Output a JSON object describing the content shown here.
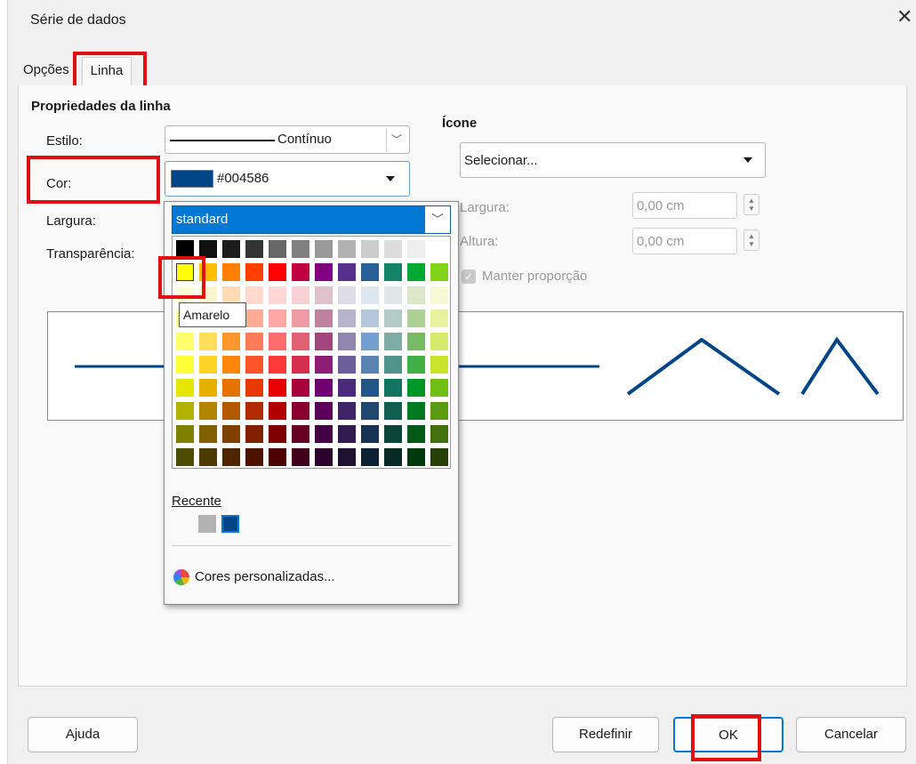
{
  "window": {
    "title": "Série de dados",
    "close": "✕"
  },
  "tabs": [
    {
      "label": "Opções"
    },
    {
      "label": "Linha"
    }
  ],
  "line_props": {
    "heading": "Propriedades da linha",
    "style_label": "Estilo:",
    "style_value": "Contínuo",
    "color_label": "Cor:",
    "color_value": "#004586",
    "color_hex": "#004586",
    "width_label": "Largura:",
    "transparency_label": "Transparência:"
  },
  "icon": {
    "heading": "Ícone",
    "select_value": "Selecionar...",
    "width_label": "Largura:",
    "width_value": "0,00 cm",
    "height_label": "Altura:",
    "height_value": "0,00 cm",
    "keep_ratio_label": "Manter proporção"
  },
  "color_popup": {
    "palette": "standard",
    "tooltip": "Amarelo",
    "recent_label": "Recente",
    "recent_colors": [
      "#b3b3b3",
      "#004586"
    ],
    "custom_label": "Cores personalizadas...",
    "swatches": [
      [
        "#000000",
        "#111111",
        "#1c1c1c",
        "#333333",
        "#666666",
        "#808080",
        "#999999",
        "#b2b2b2",
        "#cccccc",
        "#dddddd",
        "#eeeeee",
        "#ffffff"
      ],
      [
        "#ffff00",
        "#ffbf00",
        "#ff8000",
        "#ff4000",
        "#ff0000",
        "#bf0041",
        "#800080",
        "#55308d",
        "#2a6099",
        "#158466",
        "#00a933",
        "#81d41a"
      ],
      [
        "#ffffd7",
        "#fff5ce",
        "#ffdbb6",
        "#ffd8ce",
        "#ffd7d7",
        "#f7d1d5",
        "#e0c2cd",
        "#dedce6",
        "#dee6ef",
        "#dee7e5",
        "#dde8cb",
        "#f6f9d4"
      ],
      [
        "#ffffa6",
        "#ffe994",
        "#ffb66c",
        "#ffaa95",
        "#ffa6a6",
        "#ec9ba4",
        "#bf819e",
        "#b7b3ca",
        "#b4c7dc",
        "#b3cac7",
        "#afd095",
        "#e8f2a1"
      ],
      [
        "#ffff6d",
        "#ffde59",
        "#ff972f",
        "#ff7b59",
        "#ff6d6d",
        "#e16173",
        "#a1467e",
        "#8e86ae",
        "#729fcf",
        "#81aca6",
        "#77bc65",
        "#d4ea6b"
      ],
      [
        "#ffff38",
        "#ffd428",
        "#ff860d",
        "#ff5429",
        "#ff3838",
        "#d62e4e",
        "#8d1d75",
        "#6b5e9b",
        "#5983b0",
        "#50938a",
        "#3faf46",
        "#c9e32b"
      ],
      [
        "#e6e600",
        "#e6b000",
        "#e67300",
        "#e63800",
        "#e60000",
        "#a8003a",
        "#6f006f",
        "#4b2a7d",
        "#245587",
        "#137462",
        "#009628",
        "#6fbf16"
      ],
      [
        "#b2b200",
        "#b28500",
        "#b25900",
        "#b22b00",
        "#b20000",
        "#8a002f",
        "#5c005c",
        "#3e2366",
        "#1e466f",
        "#0f5e4f",
        "#007a21",
        "#5a9b12"
      ],
      [
        "#808000",
        "#806000",
        "#804000",
        "#802000",
        "#800000",
        "#650022",
        "#450045",
        "#2f1b4d",
        "#163353",
        "#0b4539",
        "#005917",
        "#41700d"
      ],
      [
        "#4d4d00",
        "#4d3a00",
        "#4d2600",
        "#4d1300",
        "#4d0000",
        "#40001a",
        "#2b002b",
        "#1d1130",
        "#0e2033",
        "#072b24",
        "#00380e",
        "#293f08"
      ]
    ]
  },
  "buttons": {
    "help": "Ajuda",
    "reset": "Redefinir",
    "ok": "OK",
    "cancel": "Cancelar"
  }
}
